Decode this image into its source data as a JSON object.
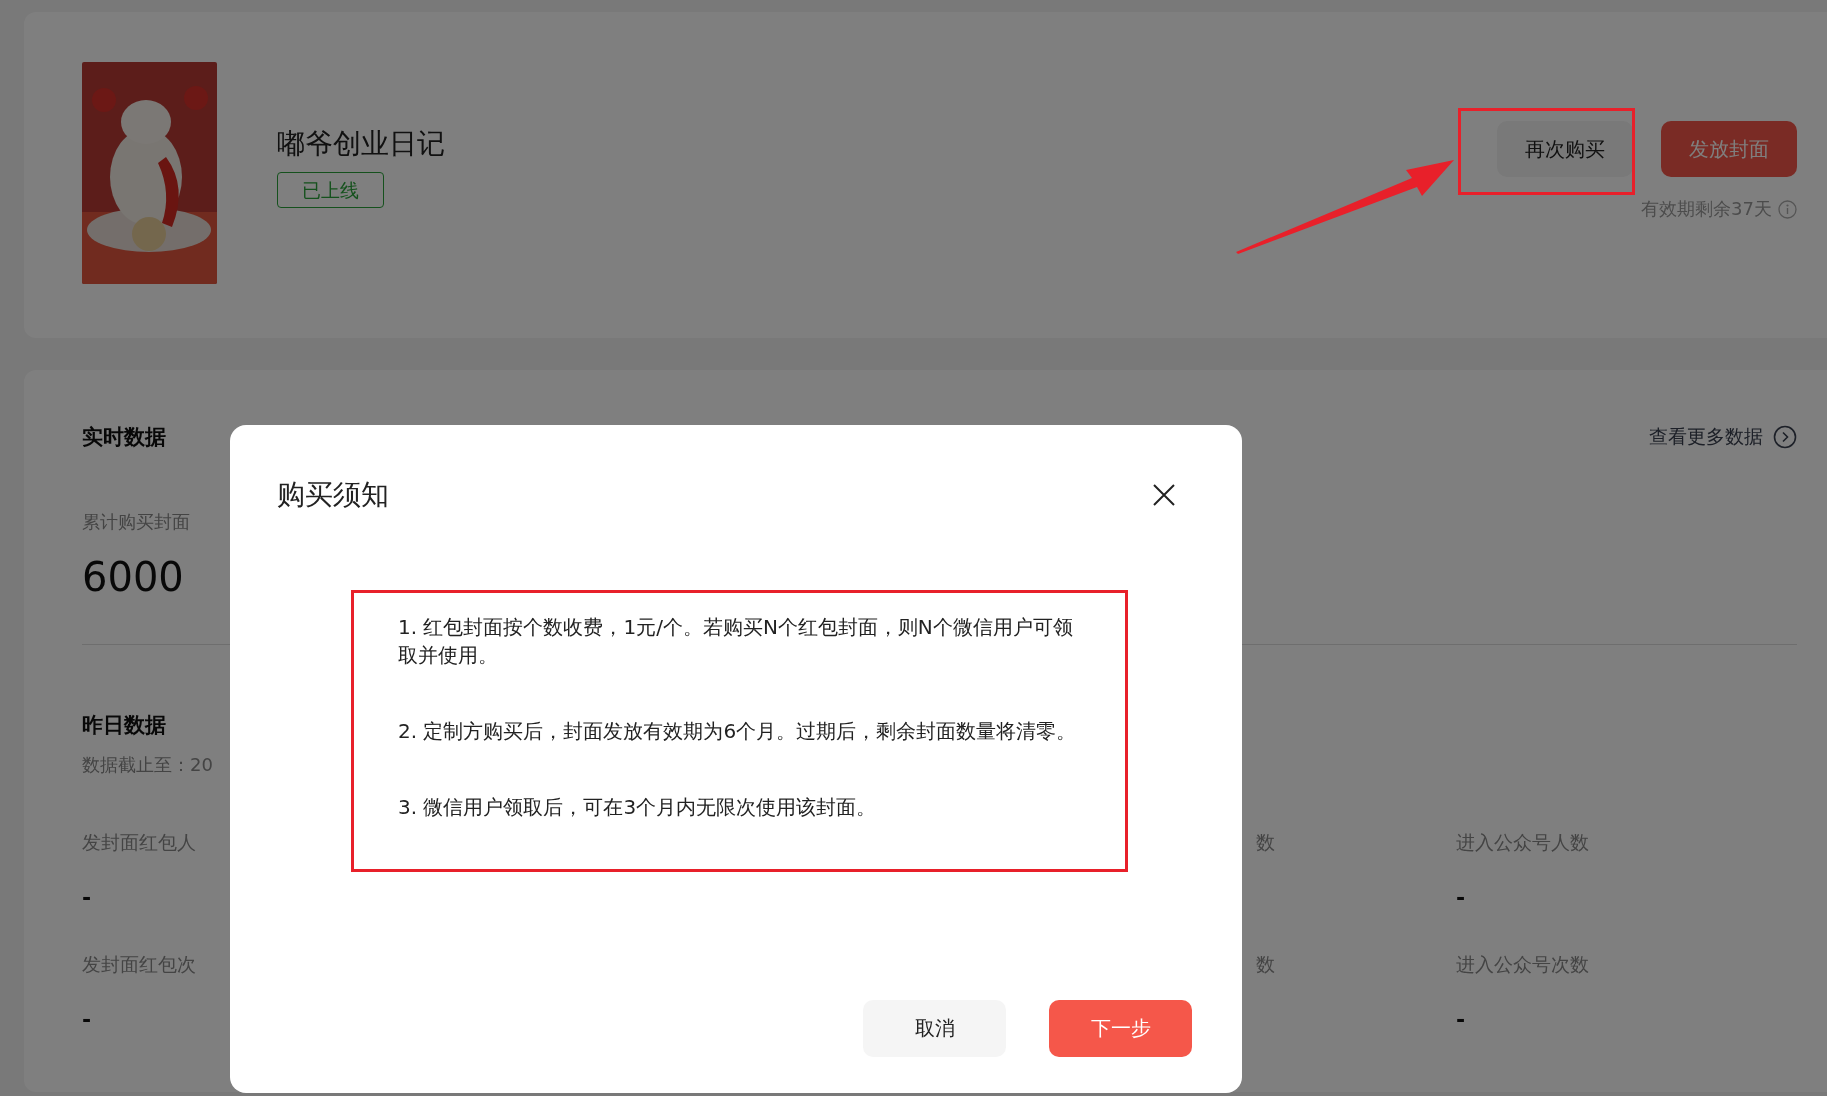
{
  "header_card": {
    "title": "嘟爷创业日记",
    "status": "已上线",
    "buttons": [
      {
        "label": "再次购买",
        "kind": "secondary"
      },
      {
        "label": "发放封面",
        "kind": "primary"
      }
    ],
    "validity": "有效期剩余37天"
  },
  "realtime": {
    "title": "实时数据",
    "more_link": "查看更多数据",
    "stat_label": "累计购买封面",
    "stat_value": "6000"
  },
  "yesterday": {
    "title": "昨日数据",
    "cutoff": "数据截止至：20",
    "rows": [
      {
        "cells": [
          {
            "label": "发封面红包人",
            "value": "-"
          },
          {
            "label": "数"
          },
          {
            "label": "进入公众号人数",
            "value": "-"
          }
        ]
      },
      {
        "cells": [
          {
            "label": "发封面红包次",
            "value": "-"
          },
          {
            "label": "数"
          },
          {
            "label": "进入公众号次数",
            "value": "-"
          }
        ]
      }
    ]
  },
  "dialog": {
    "title": "购买须知",
    "notices": [
      "1. 红包封面按个数收费，1元/个。若购买N个红包封面，则N个微信用户可领取并使用。",
      "2. 定制方购买后，封面发放有效期为6个月。过期后，剩余封面数量将清零。",
      "3. 微信用户领取后，可在3个月内无限次使用该封面。"
    ],
    "buttons": [
      {
        "label": "取消",
        "kind": "secondary"
      },
      {
        "label": "下一步",
        "kind": "primary"
      }
    ]
  }
}
